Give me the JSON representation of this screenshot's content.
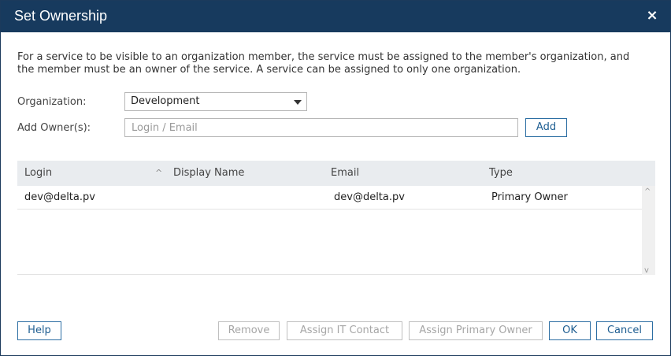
{
  "dialog": {
    "title": "Set Ownership",
    "close_icon": "×"
  },
  "description": "For a service to be visible to an organization member, the service must be assigned to the member's organization, and the member must be an owner of the service. A service can be assigned to only one organization.",
  "form": {
    "organization_label": "Organization:",
    "organization_value": "Development",
    "add_owner_label": "Add Owner(s):",
    "owner_placeholder": "Login / Email",
    "owner_value": "",
    "add_button": "Add"
  },
  "table": {
    "columns": [
      "Login",
      "Display Name",
      "Email",
      "Type"
    ],
    "sort_icon": "^",
    "rows": [
      {
        "login": "dev@delta.pv",
        "display_name": "",
        "email": "dev@delta.pv",
        "type": "Primary Owner"
      }
    ],
    "scroll_up_icon": "^",
    "scroll_down_icon": "v"
  },
  "footer": {
    "help": "Help",
    "remove": "Remove",
    "assign_it_contact": "Assign IT Contact",
    "assign_primary_owner": "Assign Primary Owner",
    "ok": "OK",
    "cancel": "Cancel"
  }
}
